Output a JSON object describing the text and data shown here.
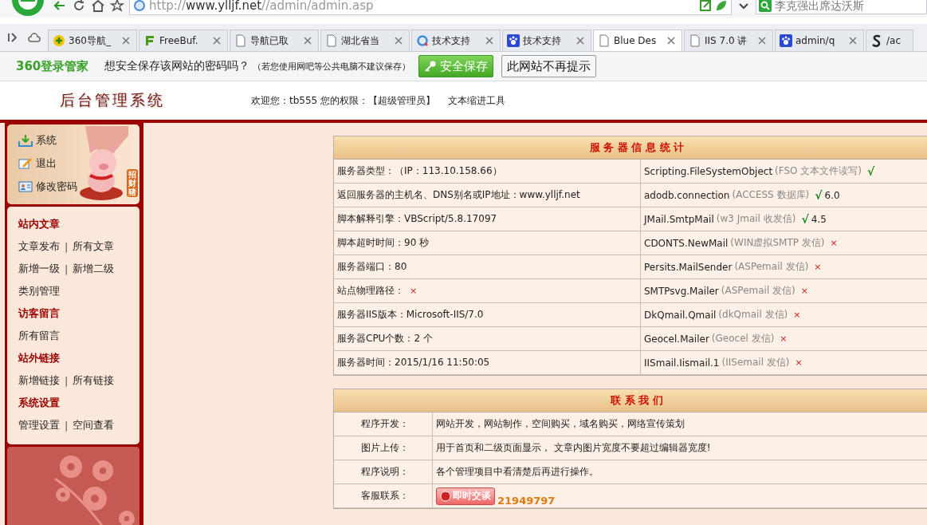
{
  "browser": {
    "url": [
      {
        "kind": "muted",
        "text": "http://"
      },
      {
        "kind": "host",
        "text": "www.ylljf.net"
      },
      {
        "kind": "muted",
        "text": "//admin/admin.asp"
      }
    ],
    "search": {
      "placeholder": "李克强出席达沃斯"
    }
  },
  "tabs": [
    {
      "label": "360导航_",
      "selected": false
    },
    {
      "label": "FreeBuf.",
      "selected": false
    },
    {
      "label": "导航已取",
      "selected": false
    },
    {
      "label": "湖北省当",
      "selected": false
    },
    {
      "label": "技术支持",
      "selected": false
    },
    {
      "label": "技术支持",
      "selected": false
    },
    {
      "label": "Blue Des",
      "selected": true
    },
    {
      "label": "IIS 7.0 讲",
      "selected": false
    },
    {
      "label": "admin/q",
      "selected": false
    },
    {
      "label": "/ac",
      "selected": false
    }
  ],
  "password_bar": {
    "brand": "360登录管家",
    "question": "想安全保存该网站的密码吗？",
    "note": "（若您使用网吧等公共电脑不建议保存）",
    "buttons": [
      {
        "kind": "primary",
        "label": "安全保存"
      },
      {
        "kind": "plain",
        "label": "此网站不再提示"
      }
    ]
  },
  "header": {
    "title": "后台管理系统",
    "welcome": "欢迎您：tb555  您的权限：【超级管理员】",
    "tool_link": "文本缩进工具"
  },
  "sidebar": {
    "top_items": [
      {
        "label": "系统"
      },
      {
        "label": "退出"
      },
      {
        "label": "修改密码"
      }
    ],
    "badge": "招财猪",
    "sections": [
      {
        "title": "站内文章",
        "rows": [
          [
            {
              "kind": "link",
              "text": "文章发布"
            },
            {
              "kind": "sep",
              "text": "|"
            },
            {
              "kind": "link",
              "text": "所有文章"
            }
          ],
          [
            {
              "kind": "link",
              "text": "新增一级"
            },
            {
              "kind": "sep",
              "text": "|"
            },
            {
              "kind": "link",
              "text": "新增二级"
            }
          ],
          [
            {
              "kind": "link",
              "text": "类别管理"
            }
          ]
        ]
      },
      {
        "title": "访客留言",
        "rows": [
          [
            {
              "kind": "link",
              "text": "所有留言"
            }
          ]
        ]
      },
      {
        "title": "站外链接",
        "rows": [
          [
            {
              "kind": "link",
              "text": "新增链接"
            },
            {
              "kind": "sep",
              "text": "|"
            },
            {
              "kind": "link",
              "text": "所有链接"
            }
          ]
        ]
      },
      {
        "title": "系统设置",
        "rows": [
          [
            {
              "kind": "link",
              "text": "管理设置"
            },
            {
              "kind": "sep",
              "text": "|"
            },
            {
              "kind": "link",
              "text": "空间查看"
            }
          ]
        ]
      }
    ]
  },
  "server_table": {
    "title": "服 务 器 信 息 统 计",
    "rows": [
      [
        [
          {
            "kind": "text",
            "text": "服务器类型：（IP：113.10.158.66）"
          }
        ],
        [
          {
            "kind": "text",
            "text": "Scripting.FileSystemObject"
          },
          {
            "kind": "muted",
            "text": "(FSO 文本文件读写)"
          },
          {
            "kind": "ok",
            "text": "√"
          }
        ]
      ],
      [
        [
          {
            "kind": "text",
            "text": "返回服务器的主机名、DNS别名或IP地址：www.ylljf.net"
          }
        ],
        [
          {
            "kind": "text",
            "text": "adodb.connection"
          },
          {
            "kind": "muted",
            "text": "(ACCESS 数据库)"
          },
          {
            "kind": "ok",
            "text": "√"
          },
          {
            "kind": "text",
            "text": "6.0"
          }
        ]
      ],
      [
        [
          {
            "kind": "text",
            "text": "脚本解释引擎：VBScript/5.8.17097"
          }
        ],
        [
          {
            "kind": "text",
            "text": "JMail.SmtpMail"
          },
          {
            "kind": "muted",
            "text": "(w3 Jmail 收发信)"
          },
          {
            "kind": "ok",
            "text": "√"
          },
          {
            "kind": "text",
            "text": "4.5"
          }
        ]
      ],
      [
        [
          {
            "kind": "text",
            "text": "脚本超时时间：90 秒"
          }
        ],
        [
          {
            "kind": "text",
            "text": "CDONTS.NewMail"
          },
          {
            "kind": "muted",
            "text": "(WIN虚拟SMTP 发信)"
          },
          {
            "kind": "fail",
            "text": "×"
          }
        ]
      ],
      [
        [
          {
            "kind": "text",
            "text": "服务器端口：80"
          }
        ],
        [
          {
            "kind": "text",
            "text": "Persits.MailSender"
          },
          {
            "kind": "muted",
            "text": "(ASPemail 发信)"
          },
          {
            "kind": "fail",
            "text": "×"
          }
        ]
      ],
      [
        [
          {
            "kind": "text",
            "text": "站点物理路径："
          },
          {
            "kind": "fail",
            "text": "×"
          }
        ],
        [
          {
            "kind": "text",
            "text": "SMTPsvg.Mailer"
          },
          {
            "kind": "muted",
            "text": "(ASPemail 发信)"
          },
          {
            "kind": "fail",
            "text": "×"
          }
        ]
      ],
      [
        [
          {
            "kind": "text",
            "text": "服务器IIS版本：Microsoft-IIS/7.0"
          }
        ],
        [
          {
            "kind": "text",
            "text": "DkQmail.Qmail"
          },
          {
            "kind": "muted",
            "text": "(dkQmail 发信)"
          },
          {
            "kind": "fail",
            "text": "×"
          }
        ]
      ],
      [
        [
          {
            "kind": "text",
            "text": "服务器CPU个数：2 个"
          }
        ],
        [
          {
            "kind": "text",
            "text": "Geocel.Mailer"
          },
          {
            "kind": "muted",
            "text": "(Geocel 发信)"
          },
          {
            "kind": "fail",
            "text": "×"
          }
        ]
      ],
      [
        [
          {
            "kind": "text",
            "text": "服务器时间：2015/1/16 11:50:05"
          }
        ],
        [
          {
            "kind": "text",
            "text": "IISmail.Iismail.1"
          },
          {
            "kind": "muted",
            "text": "(IISemail 发信)"
          },
          {
            "kind": "fail",
            "text": "×"
          }
        ]
      ]
    ]
  },
  "contact_table": {
    "title": "联 系 我 们",
    "rows": [
      {
        "kind": "text",
        "label": "程序开发：",
        "value": "网站开发，网站制作，空间购买，域名购买，网络宣传策划"
      },
      {
        "kind": "text",
        "label": "图片上传：",
        "value": "用于首页和二级页面显示， 文章内图片宽度不要超过编辑器宽度!"
      },
      {
        "kind": "text",
        "label": "程序说明：",
        "value": "各个管理项目中看清楚后再进行操作。"
      },
      {
        "kind": "chat",
        "label": "客服联系：",
        "button": "即时交谈",
        "value": "21949797"
      }
    ]
  }
}
